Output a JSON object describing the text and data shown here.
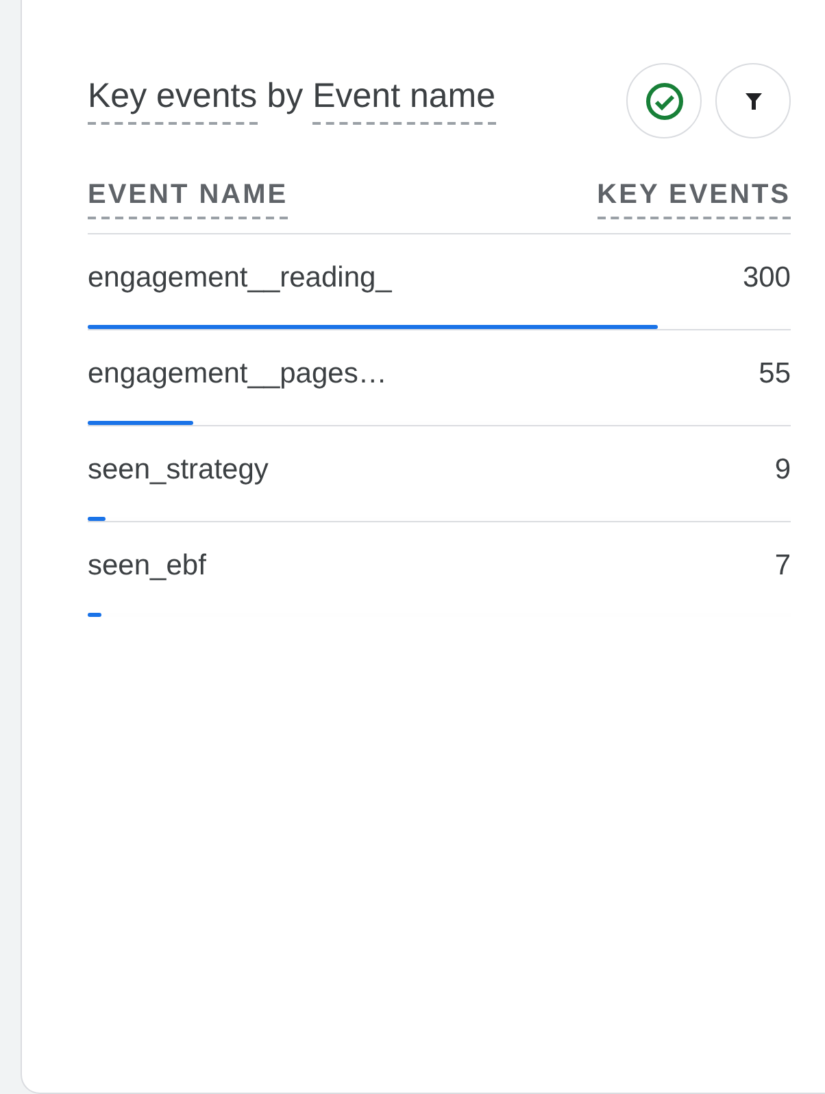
{
  "card": {
    "title_parts": [
      "Key events",
      "by",
      "Event name"
    ],
    "columns": [
      "EVENT NAME",
      "KEY EVENTS"
    ],
    "rows": [
      {
        "name": "engagement__reading_",
        "value": "300",
        "level": 0.81
      },
      {
        "name": "engagement__pages…",
        "value": "55",
        "level": 0.15
      },
      {
        "name": "seen_strategy",
        "value": "9",
        "level": 0.025
      },
      {
        "name": "seen_ebf",
        "value": "7",
        "level": 0.02
      }
    ]
  }
}
